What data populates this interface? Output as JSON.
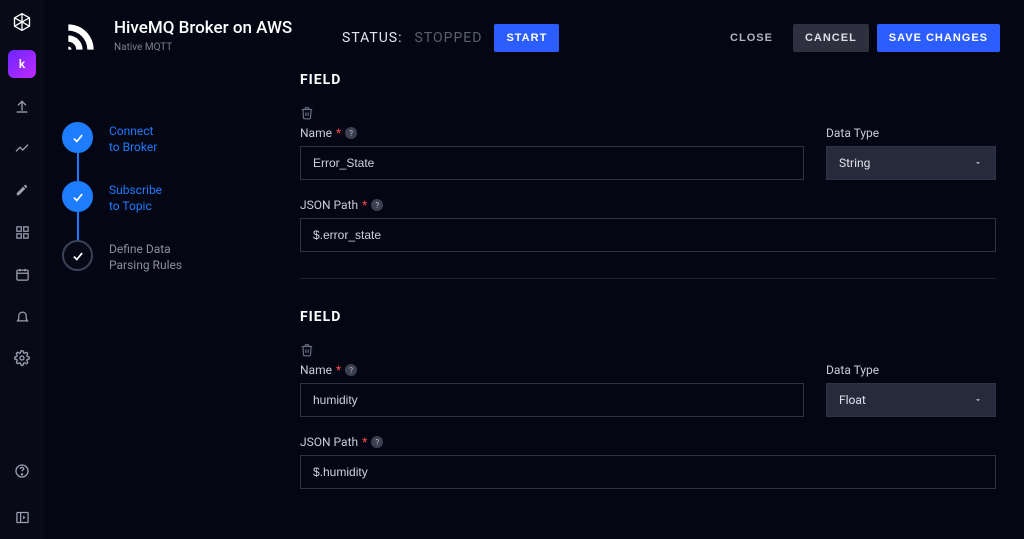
{
  "header": {
    "title": "HiveMQ Broker on AWS",
    "subtitle": "Native MQTT",
    "status_label": "STATUS:",
    "status_value": "STOPPED",
    "start_btn": "START",
    "close_btn": "CLOSE",
    "cancel_btn": "CANCEL",
    "save_btn": "SAVE CHANGES"
  },
  "steps": [
    {
      "line1": "Connect",
      "line2": "to Broker",
      "done": true
    },
    {
      "line1": "Subscribe",
      "line2": "to Topic",
      "done": true
    },
    {
      "line1": "Define Data",
      "line2": "Parsing Rules",
      "done": false
    }
  ],
  "section_title": "FIELD",
  "labels": {
    "name": "Name",
    "data_type": "Data Type",
    "json_path": "JSON Path"
  },
  "fields": [
    {
      "name": "Error_State",
      "type": "String",
      "path": "$.error_state"
    },
    {
      "name": "humidity",
      "type": "Float",
      "path": "$.humidity"
    }
  ],
  "nav_icons": [
    "logo",
    "keyed",
    "upload",
    "chart",
    "edit",
    "grid",
    "calendar",
    "bell",
    "gear"
  ],
  "bottom_icons": [
    "help",
    "panel"
  ]
}
